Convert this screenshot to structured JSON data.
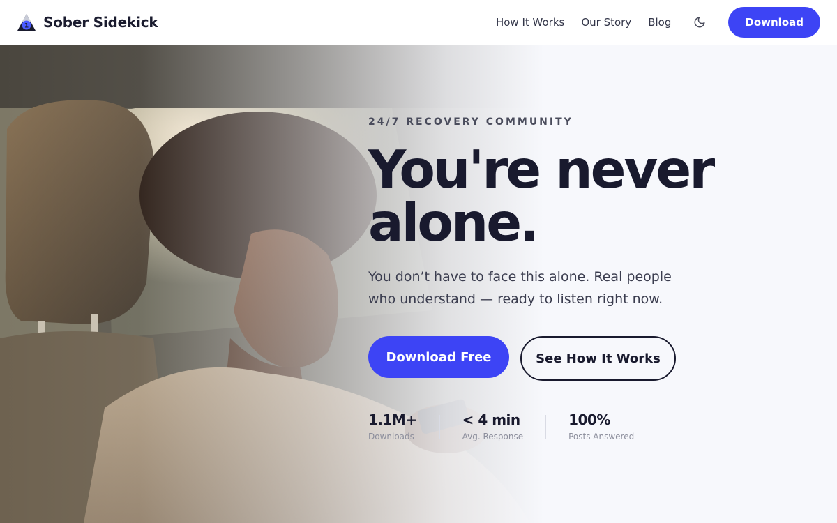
{
  "nav": {
    "brand_name": "Sober Sidekick",
    "links": [
      "How It Works",
      "Our Story",
      "Blog"
    ],
    "download_label": "Download"
  },
  "hero": {
    "eyebrow": "24/7 RECOVERY COMMUNITY",
    "headline": "You're never alone.",
    "subhead": "You don’t have to face this alone. Real people who understand — ready to listen right now.",
    "primary_cta": "Download Free",
    "secondary_cta": "See How It Works",
    "stats": [
      {
        "value": "1.1M+",
        "label": "Downloads"
      },
      {
        "value": "< 4 min",
        "label": "Avg. Response"
      },
      {
        "value": "100%",
        "label": "Posts Answered"
      }
    ]
  },
  "colors": {
    "accent": "#3d44f5",
    "text_dark": "#191a2e",
    "background": "#f7f8fc"
  },
  "icons": [
    "sober-sidekick-logo-icon",
    "moon-icon"
  ]
}
